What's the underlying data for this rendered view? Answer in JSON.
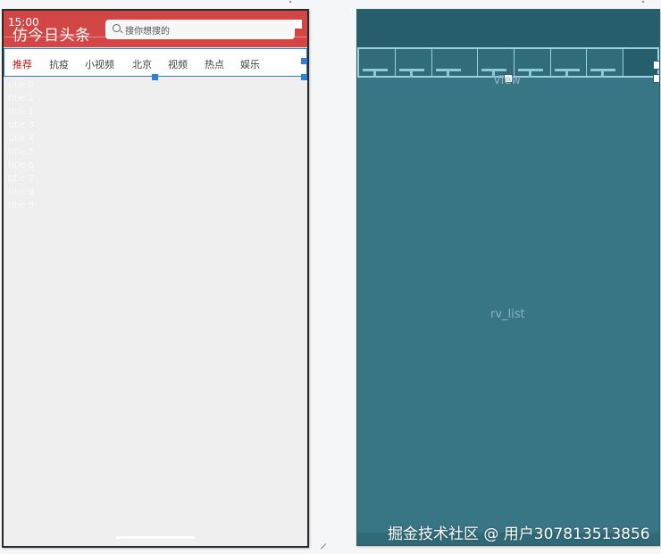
{
  "status_bar": {
    "time": "15:00"
  },
  "toolbar": {
    "title": "仿今日头条",
    "search_placeholder": "搜你想搜的"
  },
  "tabs": [
    "推荐",
    "抗疫",
    "小视频",
    "北京",
    "视频",
    "热点",
    "娱乐"
  ],
  "active_tab": "推荐",
  "rv_items": [
    "title 0",
    "title 1",
    "title 2",
    "title 3",
    "title 4",
    "title 5",
    "title 6",
    "title 7",
    "title 8",
    "title 9"
  ],
  "blueprint": {
    "view_label": "View",
    "list_label": "rv_list"
  },
  "watermark": "掘金技术社区 @ 用户307813513856",
  "colors": {
    "toolbar_red": "#d24646",
    "tab_active": "#c01818",
    "selection_blue": "#2f7fe0",
    "blueprint_bg": "#387585"
  }
}
